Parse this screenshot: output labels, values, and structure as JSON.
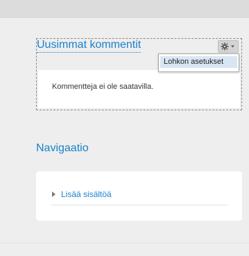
{
  "comments_block": {
    "title": "Uusimmat kommentit",
    "empty_text": "Kommentteja ei ole saatavilla.",
    "settings_menu": {
      "icon": "gear-icon",
      "items": [
        "Lohkon asetukset"
      ]
    }
  },
  "navigation_block": {
    "title": "Navigaatio",
    "items": [
      {
        "label": "Lisää sisältöä",
        "icon": "caret-right-icon"
      }
    ]
  },
  "colors": {
    "accent": "#1a80cc",
    "background": "#eeeeee",
    "menu_highlight": "#d8e6f4"
  }
}
